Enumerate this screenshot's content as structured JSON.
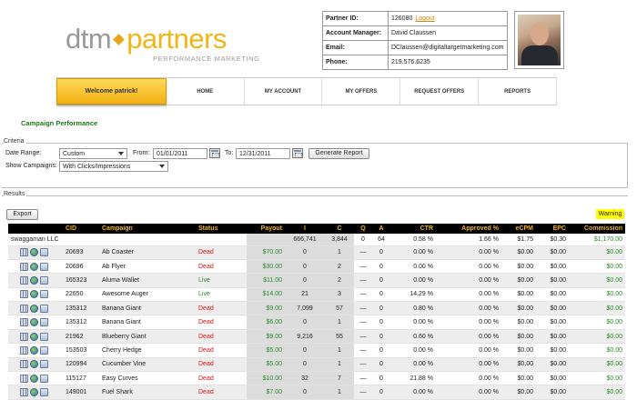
{
  "brand": {
    "name_left": "dtm",
    "name_right": "partners",
    "tagline": "PERFORMANCE MARKETING"
  },
  "account": {
    "partner_id_label": "Partner ID:",
    "partner_id": "126080",
    "logout": "Logout",
    "manager_label": "Account Manager:",
    "manager": "David Claussen",
    "email_label": "Email:",
    "email": "DClaussen@digitaltargetmarketing.com",
    "phone_label": "Phone:",
    "phone": "219.576.6235"
  },
  "nav": {
    "welcome": "Welcome patrick!",
    "items": [
      "HOME",
      "MY ACCOUNT",
      "MY OFFERS",
      "REQUEST OFFERS",
      "REPORTS"
    ]
  },
  "page_title": "Campaign Performance",
  "criteria": {
    "legend": "Criteria",
    "date_range_label": "Date Range:",
    "date_range": "Custom",
    "from_label": "From:",
    "from": "01/01/2011",
    "to_label": "To:",
    "to": "12/31/2011",
    "generate": "Generate Report",
    "show_label": "Show Campaigns:",
    "show": "With Clicks/Impressions"
  },
  "results": {
    "legend": "Results",
    "export": "Export",
    "warning": "Warning",
    "columns": [
      "",
      "CID",
      "Campaign",
      "Status",
      "Payout",
      "I",
      "C",
      "Q",
      "A",
      "CTR",
      "Approved %",
      "eCPM",
      "EPC",
      "Commission"
    ],
    "summary": {
      "name": "swaggaman LLC",
      "i": "666,741",
      "c": "3,844",
      "q": "0",
      "a": "64",
      "ctr": "0.58 %",
      "approved": "1.66 %",
      "ecpm": "$1.75",
      "epc": "$0.30",
      "commission": "$1,170.00"
    },
    "rows": [
      {
        "cid": "20693",
        "campaign": "Ab Coaster",
        "status": "Dead",
        "payout": "$70.00",
        "i": "0",
        "c": "1",
        "q": "—",
        "a": "0",
        "ctr": "0.00 %",
        "approved": "0.00 %",
        "ecpm": "$0.00",
        "epc": "$0.00",
        "commission": "$0.00"
      },
      {
        "cid": "20696",
        "campaign": "Ab Flyer",
        "status": "Dead",
        "payout": "$30.00",
        "i": "0",
        "c": "2",
        "q": "—",
        "a": "0",
        "ctr": "0.00 %",
        "approved": "0.00 %",
        "ecpm": "$0.00",
        "epc": "$0.00",
        "commission": "$0.00"
      },
      {
        "cid": "165323",
        "campaign": "Aluma Wallet",
        "status": "Live",
        "payout": "$11.00",
        "i": "0",
        "c": "2",
        "q": "—",
        "a": "0",
        "ctr": "0.00 %",
        "approved": "0.00 %",
        "ecpm": "$0.00",
        "epc": "$0.00",
        "commission": "$0.00"
      },
      {
        "cid": "22650",
        "campaign": "Awesome Auger",
        "status": "Live",
        "payout": "$14.00",
        "i": "21",
        "c": "3",
        "q": "—",
        "a": "0",
        "ctr": "14.29 %",
        "approved": "0.00 %",
        "ecpm": "$0.00",
        "epc": "$0.00",
        "commission": "$0.00"
      },
      {
        "cid": "135312",
        "campaign": "Banana Giant",
        "status": "Dead",
        "payout": "$9.00",
        "i": "7,099",
        "c": "57",
        "q": "—",
        "a": "0",
        "ctr": "0.80 %",
        "approved": "0.00 %",
        "ecpm": "$0.00",
        "epc": "$0.00",
        "commission": "$0.00"
      },
      {
        "cid": "135312",
        "campaign": "Banana Giant",
        "status": "Dead",
        "payout": "$6.00",
        "i": "0",
        "c": "1",
        "q": "—",
        "a": "0",
        "ctr": "0.00 %",
        "approved": "0.00 %",
        "ecpm": "$0.00",
        "epc": "$0.00",
        "commission": "$0.00"
      },
      {
        "cid": "21962",
        "campaign": "Blueberry Giant",
        "status": "Dead",
        "payout": "$9.00",
        "i": "9,216",
        "c": "55",
        "q": "—",
        "a": "0",
        "ctr": "0.60 %",
        "approved": "0.00 %",
        "ecpm": "$0.00",
        "epc": "$0.00",
        "commission": "$0.00"
      },
      {
        "cid": "153503",
        "campaign": "Cherry Hedge",
        "status": "Dead",
        "payout": "$5.00",
        "i": "0",
        "c": "1",
        "q": "—",
        "a": "0",
        "ctr": "0.00 %",
        "approved": "0.00 %",
        "ecpm": "$0.00",
        "epc": "$0.00",
        "commission": "$0.00"
      },
      {
        "cid": "120994",
        "campaign": "Cucumber Vine",
        "status": "Dead",
        "payout": "$5.00",
        "i": "0",
        "c": "1",
        "q": "—",
        "a": "0",
        "ctr": "0.00 %",
        "approved": "0.00 %",
        "ecpm": "$0.00",
        "epc": "$0.00",
        "commission": "$0.00"
      },
      {
        "cid": "115127",
        "campaign": "Easy Curves",
        "status": "Dead",
        "payout": "$10.00",
        "i": "32",
        "c": "7",
        "q": "—",
        "a": "0",
        "ctr": "21.88 %",
        "approved": "0.00 %",
        "ecpm": "$0.00",
        "epc": "$0.00",
        "commission": "$0.00"
      },
      {
        "cid": "149001",
        "campaign": "Fuel Shark",
        "status": "Dead",
        "payout": "$7.00",
        "i": "0",
        "c": "1",
        "q": "—",
        "a": "0",
        "ctr": "0.00 %",
        "approved": "0.00 %",
        "ecpm": "$0.00",
        "epc": "$0.00",
        "commission": "$0.00"
      }
    ]
  }
}
